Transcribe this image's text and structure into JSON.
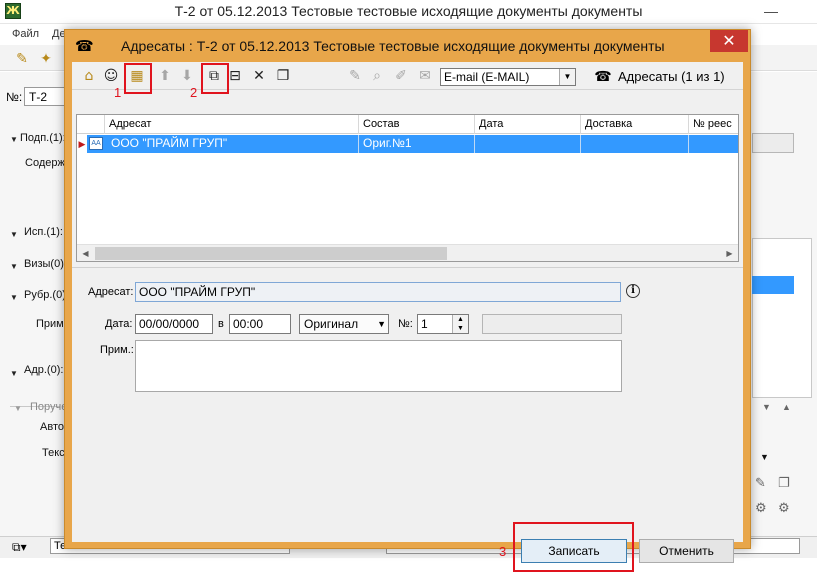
{
  "main_window": {
    "title": "Т-2 от 05.12.2013 Тестовые тестовые исходящие документы документы",
    "menu": [
      "Файл",
      "Де"
    ],
    "number_label": "№:",
    "number_value": "Т-2",
    "labels": {
      "podp": "Подп.(1):",
      "soderzh": "Содерж",
      "isp": "Исп.(1):",
      "vizy": "Визы(0)",
      "rubr": "Рубр.(0)",
      "prim": "Прим",
      "adr": "Адр.(0):",
      "poruch": "Поруче",
      "avto": "Авто",
      "teks": "Текс"
    },
    "status_left": "Тестовый",
    "status_right": "Тест"
  },
  "dialog": {
    "title": "Адресаты : Т-2 от 05.12.2013 Тестовые тестовые исходящие документы документы",
    "close_glyph": "✕",
    "delivery_method": "E-mail (E-MAIL)",
    "addressees_count": "Адресаты (1 из 1)",
    "highlight_numbers": [
      "1",
      "2",
      "3"
    ],
    "grid": {
      "columns": [
        "Адресат",
        "Состав",
        "Дата",
        "Доставка",
        "№ реес"
      ],
      "rows": [
        {
          "adresat": "ООО \"ПРАЙМ ГРУП\"",
          "sostav": "Ориг.№1",
          "data": "",
          "dostavka": "",
          "reestr": ""
        }
      ]
    },
    "details": {
      "adresat_label": "Адресат:",
      "adresat_value": "ООО \"ПРАЙМ ГРУП\"",
      "date_label": "Дата:",
      "date_value": "00/00/0000",
      "in_label": "в",
      "time_value": "00:00",
      "type_value": "Оригинал",
      "num_label": "№:",
      "num_value": "1",
      "note_label": "Прим.:",
      "note_value": ""
    },
    "buttons": {
      "save": "Записать",
      "cancel": "Отменить"
    }
  },
  "colors": {
    "dialog_frame": "#e8a64a",
    "selection": "#3399ff",
    "close": "#c7372f",
    "highlight": "#e0141e"
  },
  "icons": [
    "app-icon",
    "dialog-icon",
    "add-addressee-icon",
    "add-contact-icon",
    "add-group-icon",
    "up-arrow-icon",
    "down-arrow-icon",
    "edit-card-icon",
    "remove-card-icon",
    "delete-icon",
    "copy-icon",
    "pencil-icon",
    "preview-icon",
    "edit-doc-icon",
    "mail-icon",
    "addressees-icon",
    "info-icon"
  ]
}
